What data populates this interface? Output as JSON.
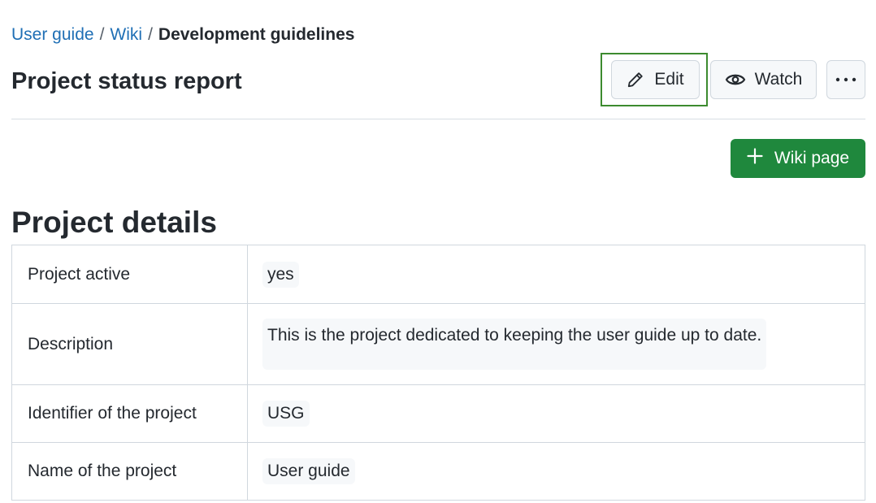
{
  "breadcrumb": {
    "items": [
      "User guide",
      "Wiki"
    ],
    "separator": "/",
    "current": "Development guidelines"
  },
  "page": {
    "title": "Project status report"
  },
  "actions": {
    "edit_label": "Edit",
    "watch_label": "Watch",
    "more_icon": "kebab-horizontal-icon",
    "new_wiki_label": "Wiki page"
  },
  "section": {
    "title": "Project details"
  },
  "details": {
    "rows": [
      {
        "key": "Project active",
        "value": "yes"
      },
      {
        "key": "Description",
        "value": "This is the project dedicated to keeping the user guide up to date."
      },
      {
        "key": "Identifier of the project",
        "value": "USG"
      },
      {
        "key": "Name of the project",
        "value": "User guide"
      }
    ]
  },
  "colors": {
    "link": "#1f6fb5",
    "primary_button": "#1f883d",
    "highlight_frame": "#3d8b2f"
  }
}
